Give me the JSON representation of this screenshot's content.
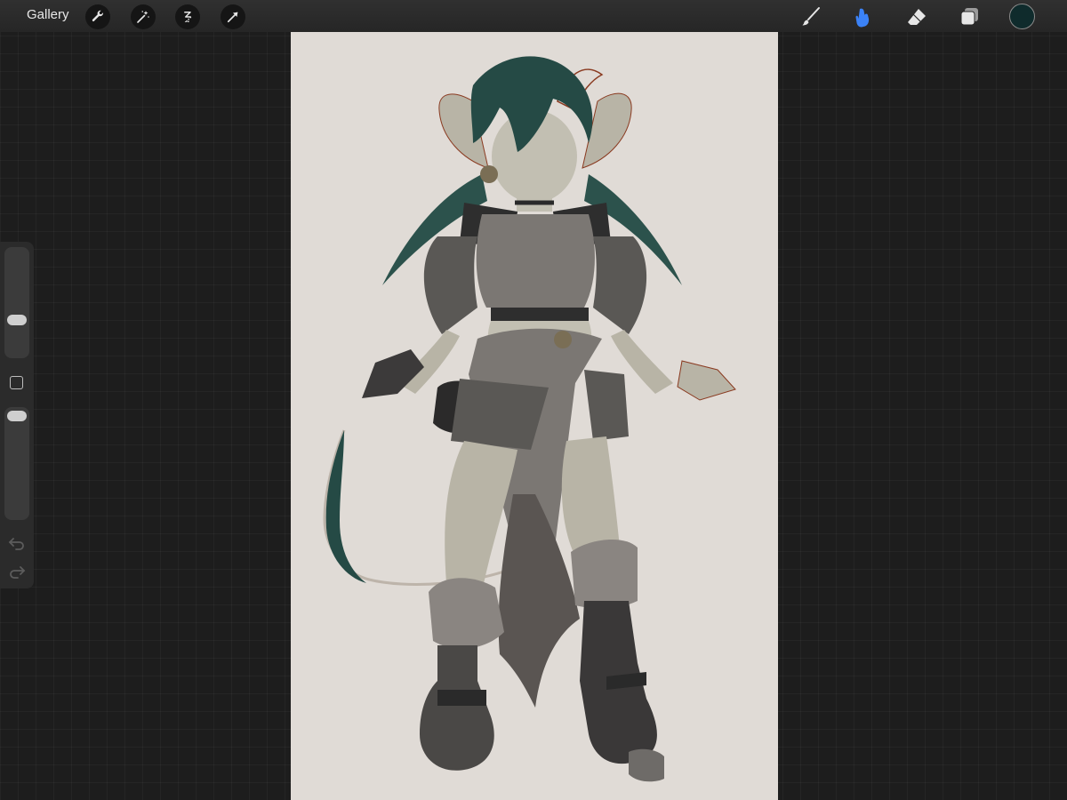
{
  "topbar": {
    "gallery_label": "Gallery",
    "left_tools": [
      "wrench-icon",
      "magic-wand-icon",
      "selection-icon",
      "transform-icon"
    ],
    "right_tools": [
      "brush-icon",
      "smudge-icon",
      "eraser-icon",
      "layers-icon"
    ],
    "active_tool": "smudge-icon"
  },
  "colors": {
    "active_tool": "#3b82f6",
    "current_color": "#0f2b2c",
    "canvas_background": "#e0dbd6"
  },
  "sidebar": {
    "controls": [
      "brush-size-slider",
      "modify-button",
      "opacity-slider",
      "undo-icon",
      "redo-icon"
    ]
  },
  "canvas": {
    "content": "character-artwork"
  }
}
